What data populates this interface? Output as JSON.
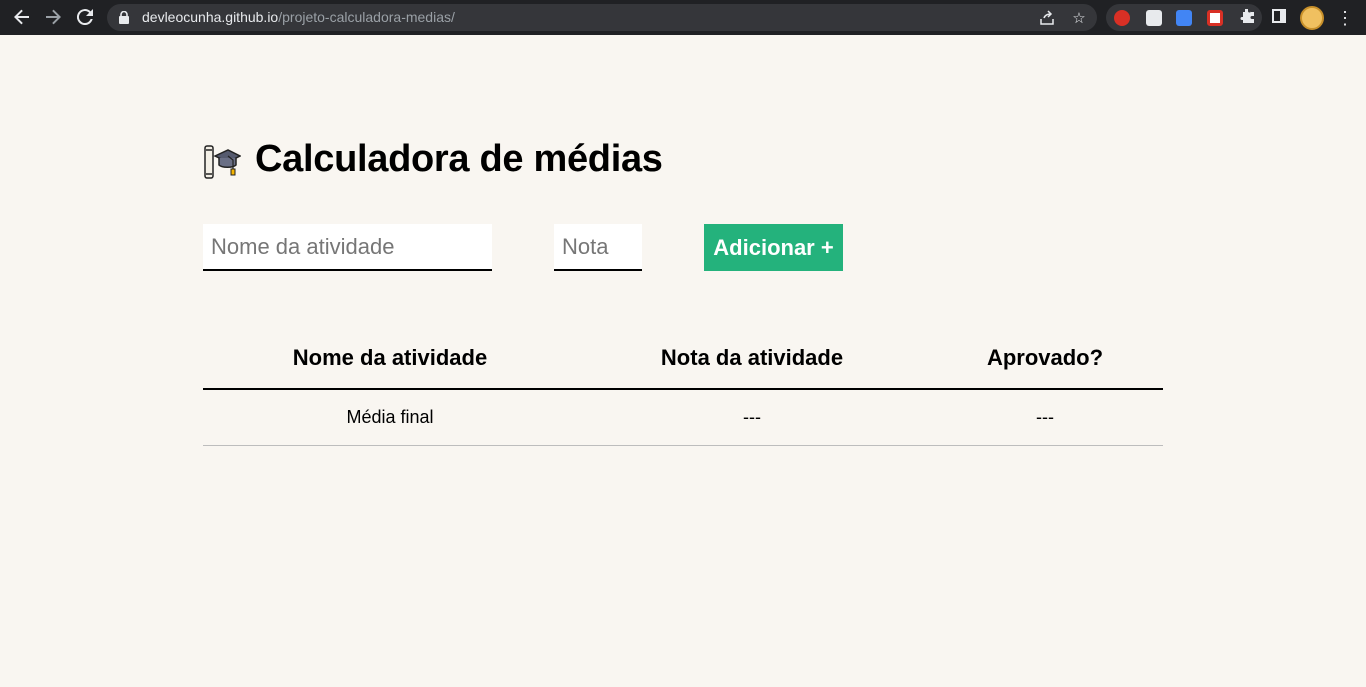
{
  "browser": {
    "url_host": "devleocunha.github.io",
    "url_path": "/projeto-calculadora-medias/"
  },
  "page": {
    "title": "Calculadora de médias",
    "title_icon": "graduation-cap-icon"
  },
  "form": {
    "activity_placeholder": "Nome da atividade",
    "grade_placeholder": "Nota",
    "add_button_label": "Adicionar +"
  },
  "table": {
    "headers": [
      "Nome da atividade",
      "Nota da atividade",
      "Aprovado?"
    ],
    "footer_row": [
      "Média final",
      "---",
      "---"
    ]
  },
  "colors": {
    "background": "#f9f6f1",
    "accent": "#24b27c"
  }
}
